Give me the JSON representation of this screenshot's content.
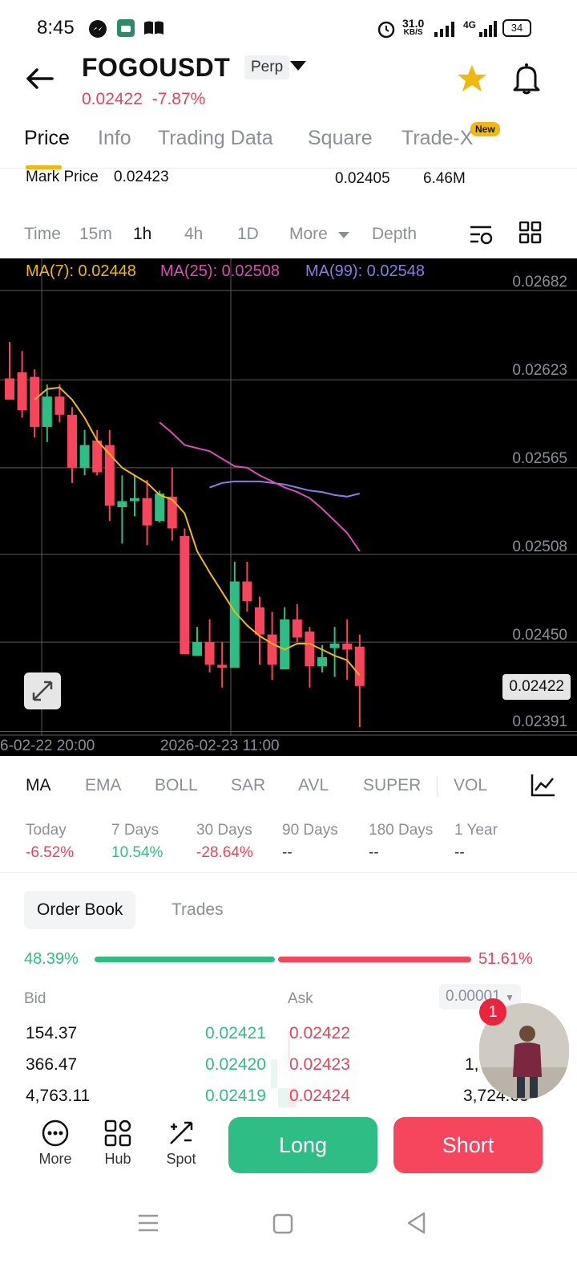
{
  "status_bar": {
    "time": "8:45",
    "net_speed_value": "31.0",
    "net_speed_unit": "KB/S",
    "network": "4G",
    "battery": "34"
  },
  "header": {
    "symbol": "FOGOUSDT",
    "contract_type": "Perp",
    "last_price": "0.02422",
    "change_pct": "-7.87%"
  },
  "tabs": [
    {
      "label": "Price",
      "active": true
    },
    {
      "label": "Info"
    },
    {
      "label": "Trading Data"
    },
    {
      "label": "Square"
    },
    {
      "label": "Trade-X",
      "badge": "New"
    }
  ],
  "mark_row": {
    "mark_label": "Mark Price",
    "mark_value": "0.02423",
    "low_value": "0.02405",
    "volume": "6.46M"
  },
  "timeframes": {
    "time": "Time",
    "m15": "15m",
    "h1": "1h",
    "h4": "4h",
    "d1": "1D",
    "more": "More",
    "depth": "Depth"
  },
  "chart": {
    "ma7": "MA(7): 0.02448",
    "ma25": "MA(25): 0.02508",
    "ma99": "MA(99): 0.02548",
    "y_labels": [
      "0.02682",
      "0.02623",
      "0.02565",
      "0.02508",
      "0.02450",
      "0.02391"
    ],
    "current_price": "0.02422",
    "x_labels": [
      "6-02-22 20:00",
      "2026-02-23 11:00"
    ],
    "colors": {
      "up": "#2ebd85",
      "down": "#f6465d",
      "ma7": "#f0b90b",
      "ma25": "#d94fb0",
      "ma99": "#8c7ae6"
    }
  },
  "chart_data": {
    "type": "candlestick",
    "interval": "1h",
    "ylim": [
      0.02391,
      0.02682
    ],
    "y_ticks": [
      0.02682,
      0.02623,
      0.02565,
      0.02508,
      0.0245,
      0.02391
    ],
    "candles": [
      {
        "o": 0.02624,
        "h": 0.02648,
        "l": 0.02612,
        "c": 0.0261
      },
      {
        "o": 0.02628,
        "h": 0.02642,
        "l": 0.02598,
        "c": 0.02603
      },
      {
        "o": 0.02625,
        "h": 0.0263,
        "l": 0.02585,
        "c": 0.02592
      },
      {
        "o": 0.02592,
        "h": 0.0262,
        "l": 0.02582,
        "c": 0.02612
      },
      {
        "o": 0.02612,
        "h": 0.0262,
        "l": 0.02595,
        "c": 0.026
      },
      {
        "o": 0.026,
        "h": 0.02605,
        "l": 0.02555,
        "c": 0.02565
      },
      {
        "o": 0.02565,
        "h": 0.0259,
        "l": 0.0256,
        "c": 0.0258
      },
      {
        "o": 0.02583,
        "h": 0.0259,
        "l": 0.0256,
        "c": 0.02562
      },
      {
        "o": 0.0258,
        "h": 0.0259,
        "l": 0.0253,
        "c": 0.0254
      },
      {
        "o": 0.02539,
        "h": 0.0256,
        "l": 0.02515,
        "c": 0.02543
      },
      {
        "o": 0.02543,
        "h": 0.0256,
        "l": 0.02533,
        "c": 0.02545
      },
      {
        "o": 0.02545,
        "h": 0.02557,
        "l": 0.02514,
        "c": 0.02527
      },
      {
        "o": 0.0253,
        "h": 0.0255,
        "l": 0.02529,
        "c": 0.02548
      },
      {
        "o": 0.02546,
        "h": 0.02565,
        "l": 0.02517,
        "c": 0.02525
      },
      {
        "o": 0.0252,
        "h": 0.02525,
        "l": 0.02442,
        "c": 0.02442
      },
      {
        "o": 0.02441,
        "h": 0.0246,
        "l": 0.02441,
        "c": 0.0245
      },
      {
        "o": 0.0245,
        "h": 0.02465,
        "l": 0.0243,
        "c": 0.02435
      },
      {
        "o": 0.02435,
        "h": 0.0245,
        "l": 0.0242,
        "c": 0.02433
      },
      {
        "o": 0.02433,
        "h": 0.02503,
        "l": 0.02433,
        "c": 0.0249
      },
      {
        "o": 0.0249,
        "h": 0.02503,
        "l": 0.0247,
        "c": 0.02477
      },
      {
        "o": 0.02473,
        "h": 0.0248,
        "l": 0.02435,
        "c": 0.02455
      },
      {
        "o": 0.02455,
        "h": 0.0247,
        "l": 0.02425,
        "c": 0.02435
      },
      {
        "o": 0.02432,
        "h": 0.02473,
        "l": 0.02432,
        "c": 0.02465
      },
      {
        "o": 0.02465,
        "h": 0.02475,
        "l": 0.0245,
        "c": 0.02453
      },
      {
        "o": 0.02457,
        "h": 0.0246,
        "l": 0.0242,
        "c": 0.02434
      },
      {
        "o": 0.02434,
        "h": 0.02448,
        "l": 0.0243,
        "c": 0.0244
      },
      {
        "o": 0.02446,
        "h": 0.0246,
        "l": 0.02427,
        "c": 0.02449
      },
      {
        "o": 0.02449,
        "h": 0.02465,
        "l": 0.02425,
        "c": 0.02445
      },
      {
        "o": 0.02447,
        "h": 0.02455,
        "l": 0.02394,
        "c": 0.02421
      }
    ],
    "ma7": [
      0.0261,
      0.02617,
      0.02618,
      0.0261,
      0.02598,
      0.02583,
      0.02574,
      0.02565,
      0.0256,
      0.02555,
      0.02547,
      0.02544,
      0.02535,
      0.0251,
      0.02496,
      0.02483,
      0.0247,
      0.02461,
      0.02454,
      0.02449,
      0.02445,
      0.02449,
      0.02449,
      0.02445,
      0.02441,
      0.02438,
      0.02428
    ],
    "ma25": [
      0.02595,
      0.02588,
      0.0258,
      0.02578,
      0.02576,
      0.02571,
      0.02566,
      0.02565,
      0.0256,
      0.02556,
      0.02552,
      0.02549,
      0.02545,
      0.02538,
      0.0253,
      0.02522,
      0.0251
    ],
    "ma99": [
      0.02552,
      0.02555,
      0.02556,
      0.02556,
      0.02556,
      0.02555,
      0.02554,
      0.02552,
      0.0255,
      0.02549,
      0.02547,
      0.02546,
      0.02548
    ]
  },
  "indicators": [
    "MA",
    "EMA",
    "BOLL",
    "SAR",
    "AVL",
    "SUPER",
    "VOL"
  ],
  "performance": [
    {
      "label": "Today",
      "value": "-6.52%"
    },
    {
      "label": "7 Days",
      "value": "10.54%"
    },
    {
      "label": "30 Days",
      "value": "-28.64%"
    },
    {
      "label": "90 Days",
      "value": "--"
    },
    {
      "label": "180 Days",
      "value": "--"
    },
    {
      "label": "1 Year",
      "value": "--"
    }
  ],
  "order_book": {
    "tabs": [
      "Order Book",
      "Trades"
    ],
    "bid_pct": "48.39%",
    "ask_pct": "51.61%",
    "bid_ratio": 0.4839,
    "bid_label": "Bid",
    "ask_label": "Ask",
    "step": "0.00001",
    "rows": [
      {
        "bid_qty": "154.37",
        "bid_price": "0.02421",
        "ask_price": "0.02422",
        "ask_qty": "5"
      },
      {
        "bid_qty": "366.47",
        "bid_price": "0.02420",
        "ask_price": "0.02423",
        "ask_qty": "1,"
      },
      {
        "bid_qty": "4,763.11",
        "bid_price": "0.02419",
        "ask_price": "0.02424",
        "ask_qty": "3,724.63"
      }
    ]
  },
  "overlay": {
    "badge_count": "1"
  },
  "bottom_nav": {
    "more": "More",
    "hub": "Hub",
    "spot": "Spot",
    "long": "Long",
    "short": "Short"
  }
}
